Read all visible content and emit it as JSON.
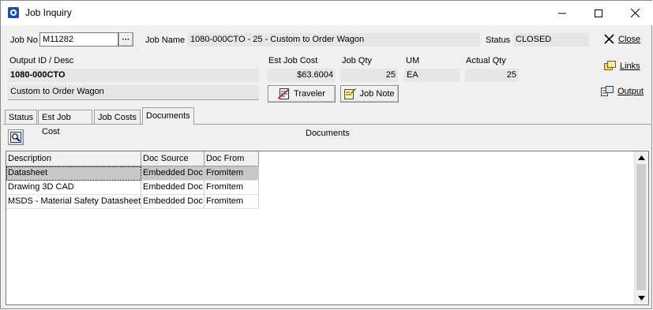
{
  "window": {
    "title": "Job Inquiry"
  },
  "header": {
    "job_no_label": "Job No",
    "job_no_value": "M11282",
    "job_no_lookup": "···",
    "job_name_label": "Job Name",
    "job_name_value": "1080-000CTO - 25 - Custom to Order Wagon",
    "status_label": "Status",
    "status_value": "CLOSED",
    "output_label": "Output ID / Desc",
    "output_id": "1080-000CTO",
    "output_desc": "Custom to Order Wagon",
    "est_cost_label": "Est Job Cost",
    "est_cost_value": "$63.6004",
    "job_qty_label": "Job Qty",
    "job_qty_value": "25",
    "um_label": "UM",
    "um_value": "EA",
    "actual_qty_label": "Actual Qty",
    "actual_qty_value": "25",
    "traveler_button": "Traveler",
    "job_note_button": "Job Note"
  },
  "side_buttons": {
    "close": "Close",
    "links": "Links",
    "output": "Output"
  },
  "tabs": [
    {
      "label": "Status"
    },
    {
      "label": "Est Job Cost"
    },
    {
      "label": "Job Costs"
    },
    {
      "label": "Documents"
    }
  ],
  "documents": {
    "title": "Documents",
    "columns": [
      "Description",
      "Doc Source",
      "Doc From"
    ],
    "rows": [
      [
        "Datasheet",
        "Embedded Doc",
        "FromItem"
      ],
      [
        "Drawing 3D CAD",
        "Embedded Doc",
        "FromItem"
      ],
      [
        "MSDS - Material Safety Datasheet",
        "Embedded Doc",
        "FromItem"
      ]
    ]
  }
}
